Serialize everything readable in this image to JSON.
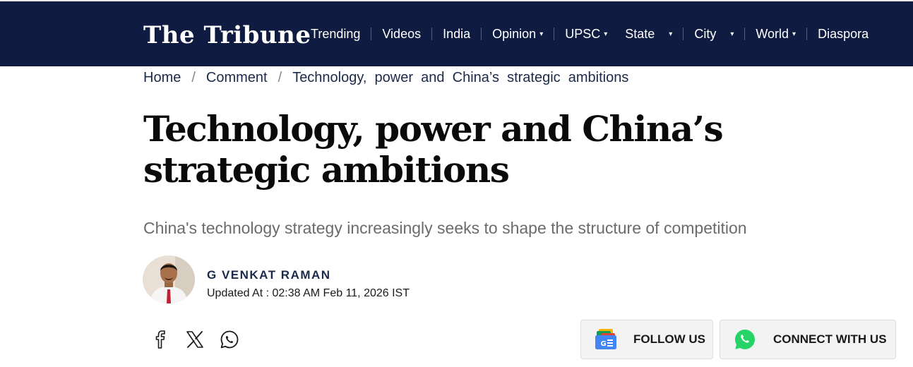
{
  "site": {
    "logo": "The Tribune"
  },
  "nav": {
    "items": [
      {
        "label": "Trending",
        "dropdown": false
      },
      {
        "label": "Videos",
        "dropdown": false
      },
      {
        "label": "India",
        "dropdown": false
      },
      {
        "label": "Opinion",
        "dropdown": true
      },
      {
        "label": "UPSC",
        "dropdown": true
      },
      {
        "label": "State",
        "dropdown": true
      },
      {
        "label": "City",
        "dropdown": true
      },
      {
        "label": "World",
        "dropdown": true
      },
      {
        "label": "Diaspora",
        "dropdown": false
      }
    ],
    "caret_glyph": "▾"
  },
  "breadcrumb": {
    "home": "Home",
    "section": "Comment",
    "current": "Technology,  power  and  China’s  strategic  ambitions",
    "separator": "/"
  },
  "article": {
    "headline": "Technology, power and China’s strategic ambitions",
    "subheadline": "China's technology strategy increasingly seeks to shape the structure of competition",
    "author": "G VENKAT RAMAN",
    "updated": "Updated At : 02:38 AM Feb 11, 2026 IST"
  },
  "share": {
    "icons": [
      "facebook-icon",
      "x-icon",
      "whatsapp-icon"
    ]
  },
  "actions": {
    "follow_label": "FOLLOW US",
    "connect_label": "CONNECT WITH US"
  },
  "colors": {
    "nav_bg": "#0f1b40",
    "text_navy": "#1b2a4a",
    "whatsapp_green": "#25d366",
    "button_bg": "#f3f3f3"
  }
}
